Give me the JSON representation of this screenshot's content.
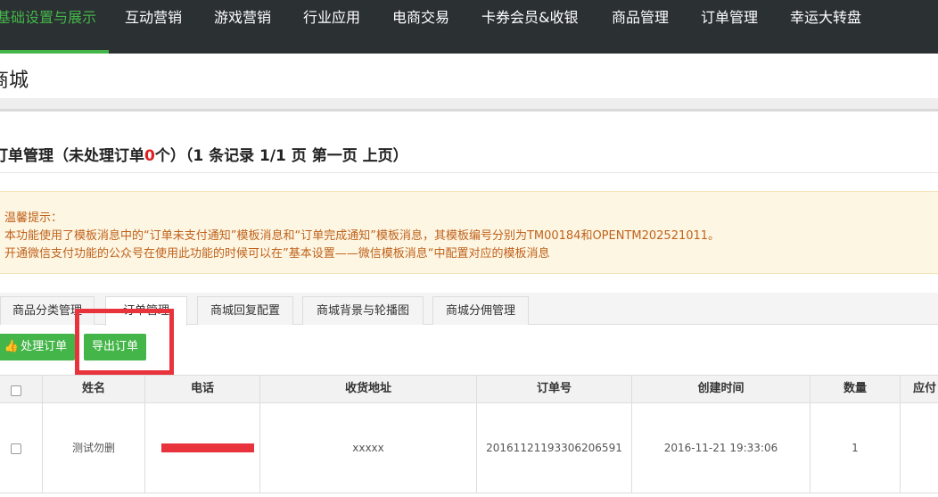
{
  "nav": {
    "items": [
      "基础设置与展示",
      "互动营销",
      "游戏营销",
      "行业应用",
      "电商交易",
      "卡券会员&收银",
      "商品管理",
      "订单管理",
      "幸运大转盘"
    ]
  },
  "page": {
    "title": "商城"
  },
  "orders": {
    "heading_prefix": "订单管理（未处理订单",
    "unprocessed_count": "0",
    "heading_suffix": "个）（1 条记录 1/1 页 第一页 上页）"
  },
  "notice": {
    "line1": "温馨提示：",
    "line2": "本功能使用了模板消息中的“订单未支付通知”模板消息和“订单完成通知”模板消息，其模板编号分别为TM00184和OPENTM202521011。",
    "line3": "开通微信支付功能的公众号在使用此功能的时候可以在”基本设置——微信模板消息“中配置对应的模板消息"
  },
  "tabs": [
    "商品分类管理",
    "订单管理",
    "商城回复配置",
    "商城背景与轮播图",
    "商城分佣管理"
  ],
  "actions": {
    "process": "处理订单",
    "export": "导出订单"
  },
  "table": {
    "headers": [
      "姓名",
      "电话",
      "收货地址",
      "订单号",
      "创建时间",
      "数量",
      "应付"
    ],
    "rows": [
      {
        "name": "测试勿删",
        "address": "xxxxx",
        "order_no": "20161121193306206591",
        "created": "2016-11-21 19:33:06",
        "qty": "1"
      }
    ]
  },
  "colors": {
    "accent": "#44b549",
    "nav_bg": "#2b3033",
    "highlight": "#e8323c",
    "notice_text": "#c0621b"
  },
  "icons": {
    "process_button": "thumbs-up-icon"
  }
}
